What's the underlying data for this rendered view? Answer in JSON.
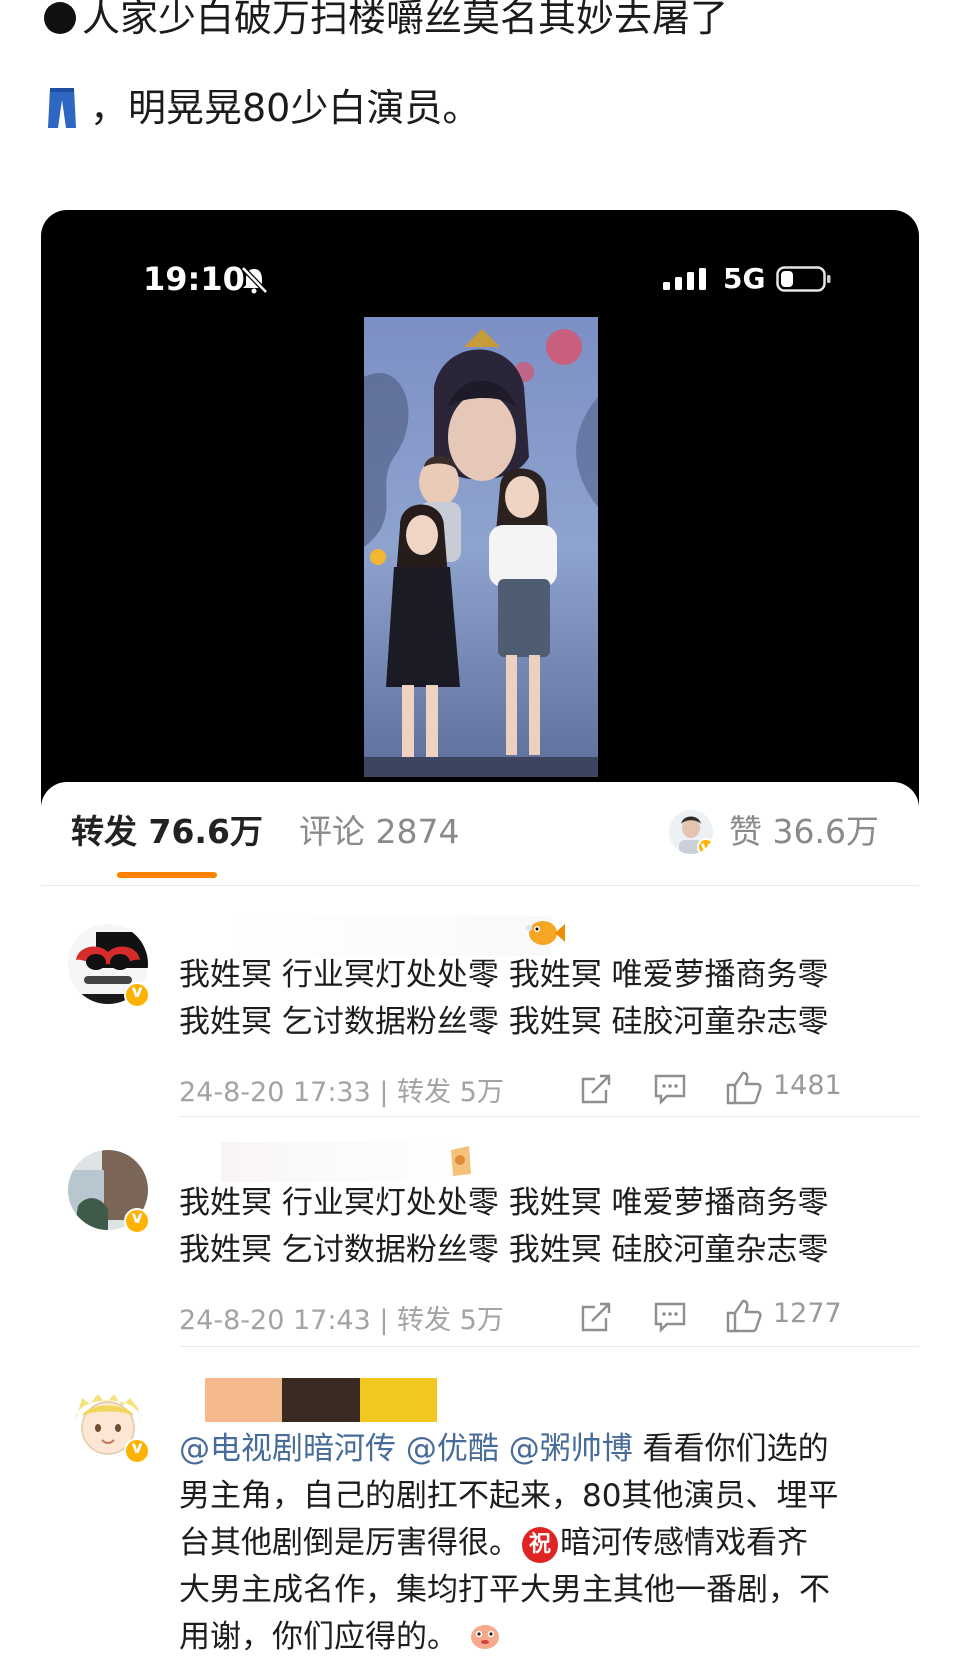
{
  "intro": {
    "line1": "人家少白破万扫楼嚼丝莫名其妙去屠了",
    "line2": "，明晃晃80少白演员。"
  },
  "status_bar": {
    "time": "19:10",
    "network": "5G"
  },
  "stats": {
    "repost_label": "转发",
    "repost_count": "76.6万",
    "comment_label": "评论",
    "comment_count": "2874",
    "like_label": "赞",
    "like_count": "36.6万"
  },
  "comments": [
    {
      "line1": "我姓冥 行业冥灯处处零 我姓冥 唯爱萝播商务零",
      "line2": "我姓冥 乞讨数据粉丝零 我姓冥 硅胶河童杂志零",
      "time": "24-8-20 17:33",
      "repost": "| 转发 5万",
      "likes": "1481"
    },
    {
      "line1": "我姓冥 行业冥灯处处零 我姓冥 唯爱萝播商务零",
      "line2": "我姓冥 乞讨数据粉丝零 我姓冥 硅胶河童杂志零",
      "time": "24-8-20 17:43",
      "repost": "| 转发 5万",
      "likes": "1277"
    },
    {
      "mentions": [
        "@电视剧暗河传",
        "@优酷",
        "@粥帅博"
      ],
      "text_a": " 看看你们选的",
      "line2": "男主角，自己的剧扛不起来，80其他演员、埋平",
      "line3_a": "台其他剧倒是厉害得很。",
      "zhu": "祝",
      "line3_b": "暗河传感情戏看齐",
      "line4": "大男主成名作，集均打平大男主其他一番剧，不",
      "line5": "用谢，你们应得的。"
    }
  ],
  "icons": {
    "bell": "bell-muted-icon",
    "signal": "signal-icon",
    "battery": "battery-icon",
    "share": "share-icon",
    "comment": "comment-icon",
    "like": "thumb-up-icon",
    "verified": "verified-badge-icon"
  },
  "colors": {
    "accent": "#ff8200",
    "mention": "#486c9a",
    "verified": "#ffb200"
  }
}
